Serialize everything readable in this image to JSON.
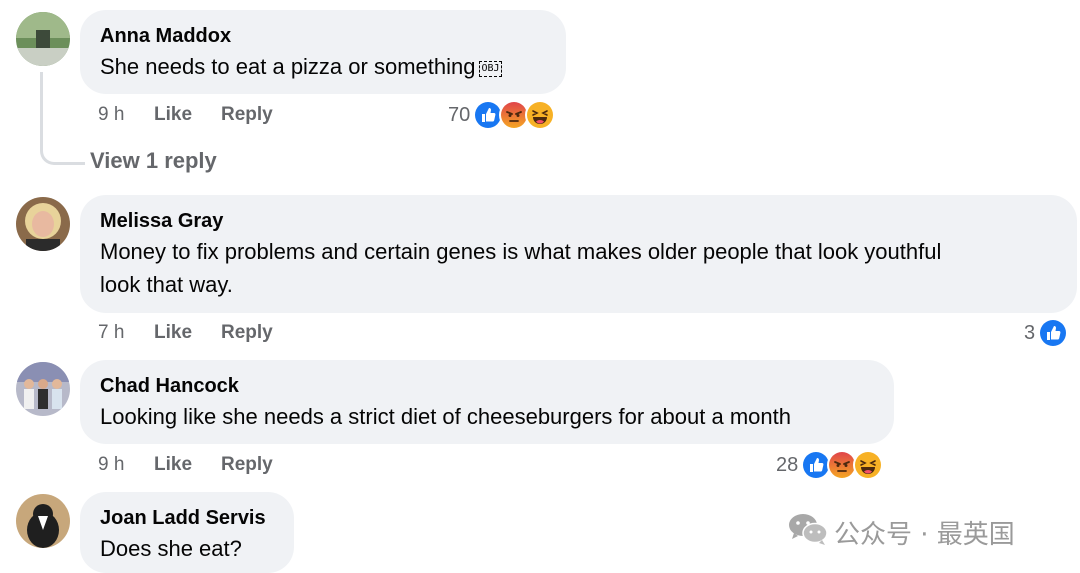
{
  "comments": [
    {
      "author": "Anna Maddox",
      "text": "She needs to eat a pizza or something",
      "badge": "OBJ",
      "time": "9 h",
      "like": "Like",
      "reply": "Reply",
      "reaction_count": "70",
      "reactions": [
        "like-icon",
        "angry-icon",
        "haha-icon"
      ],
      "view_replies": "View 1 reply"
    },
    {
      "author": "Melissa Gray",
      "text_line1": "Money to fix problems and certain genes is what makes older people that look youthful",
      "text_line2": "look that way.",
      "time": "7 h",
      "like": "Like",
      "reply": "Reply",
      "reaction_count": "3",
      "reactions": [
        "like-icon"
      ]
    },
    {
      "author": "Chad Hancock",
      "text": "Looking like she needs a strict diet of cheeseburgers for about a month",
      "time": "9 h",
      "like": "Like",
      "reply": "Reply",
      "reaction_count": "28",
      "reactions": [
        "like-icon",
        "angry-icon",
        "haha-icon"
      ]
    },
    {
      "author": "Joan Ladd Servis",
      "text": "Does she eat?"
    }
  ],
  "watermark": {
    "text": "公众号 · 最英国",
    "icon": "wechat-icon"
  },
  "colors": {
    "bubble": "#f0f2f5",
    "meta": "#65676b",
    "like_blue": "#1877f2",
    "angry": "#e9710f",
    "haha": "#f7b125"
  }
}
